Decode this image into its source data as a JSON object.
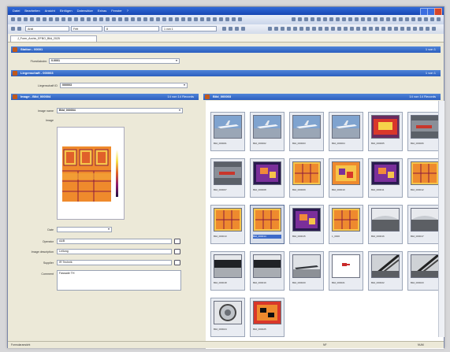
{
  "menu": [
    "Datei",
    "Bearbeiten",
    "Ansicht",
    "Einfügen",
    "Datensätze",
    "Extras",
    "Fenster",
    "?"
  ],
  "toolbar": {
    "font_name": "Arial",
    "font_style": "Fett",
    "font_size": "8",
    "record_field": "1 von 1"
  },
  "doc_tab": "J_Form_Archiv_EFBO_Bild_2025",
  "sections": {
    "station": {
      "title": "Station - 00001",
      "right": "1 von 1"
    },
    "liegenschaft": {
      "title": "Liegenschaft - 000003",
      "right": "1 von 1"
    },
    "image": {
      "title": "Image - Bild_000004",
      "right": "14 von 14 Records"
    },
    "gallery": {
      "title": "Bild_000003",
      "right": "14 von 14 Records"
    }
  },
  "station_row": {
    "label": "Flurstückstnr.",
    "value": "0.0001"
  },
  "liegenschaft_row": {
    "label": "Liegenschaft ID",
    "value": "000003"
  },
  "image_form": {
    "name_label": "Image name",
    "name_value": "Bild_000004",
    "image_label": "Image",
    "date_label": "Date",
    "operator_label": "Operator",
    "descr_label": "Image description",
    "descr_value": "Leitung",
    "supplier_label": "Supplier",
    "supplier_value": "IR Technik",
    "comment_label": "Comment",
    "comment_value": "Fassade TH",
    "operator_value": "A&B"
  },
  "thumbnails": [
    {
      "caption": "Bild_000001",
      "kind": "plane"
    },
    {
      "caption": "Bild_000002",
      "kind": "plane"
    },
    {
      "caption": "Bild_000003",
      "kind": "plane"
    },
    {
      "caption": "Bild_000004",
      "kind": "plane"
    },
    {
      "caption": "Bild_000005",
      "kind": "thermal_red"
    },
    {
      "caption": "Bild_000006",
      "kind": "hangar_red"
    },
    {
      "caption": "Bild_000007",
      "kind": "hangar_red"
    },
    {
      "caption": "Bild_000008",
      "kind": "thermal_purple"
    },
    {
      "caption": "Bild_000009",
      "kind": "thermal_orange"
    },
    {
      "caption": "Bild_000010",
      "kind": "thermal_mix"
    },
    {
      "caption": "Bild_000011",
      "kind": "thermal_purple"
    },
    {
      "caption": "Bild_000012",
      "kind": "thermal_orange"
    },
    {
      "caption": "Bild_000013",
      "kind": "thermal_orange"
    },
    {
      "caption": "Bild_000014",
      "kind": "thermal_orange",
      "selected": true
    },
    {
      "caption": "Bild_000015",
      "kind": "thermal_purple"
    },
    {
      "caption": "1_0000",
      "kind": "thermal_orange"
    },
    {
      "caption": "Bild_000016",
      "kind": "hall_gray"
    },
    {
      "caption": "Bild_000017",
      "kind": "hall_gray"
    },
    {
      "caption": "Bild_000018",
      "kind": "bw_hangar"
    },
    {
      "caption": "Bild_000019",
      "kind": "bw_hangar"
    },
    {
      "caption": "Bild_000020",
      "kind": "bw_plane"
    },
    {
      "caption": "Bild_000021",
      "kind": "white_sign"
    },
    {
      "caption": "Bild_000022",
      "kind": "bw_struct"
    },
    {
      "caption": "Bild_000023",
      "kind": "bw_struct"
    },
    {
      "caption": "Bild_000024",
      "kind": "bw_round"
    },
    {
      "caption": "Bild_000025",
      "kind": "thermal_dark"
    }
  ],
  "statusbar": {
    "left": "Formularansicht",
    "mid": "NF",
    "right": "NUM"
  },
  "colors": {
    "accent": "#2c5fbf",
    "section_icon": "#c2581a"
  }
}
